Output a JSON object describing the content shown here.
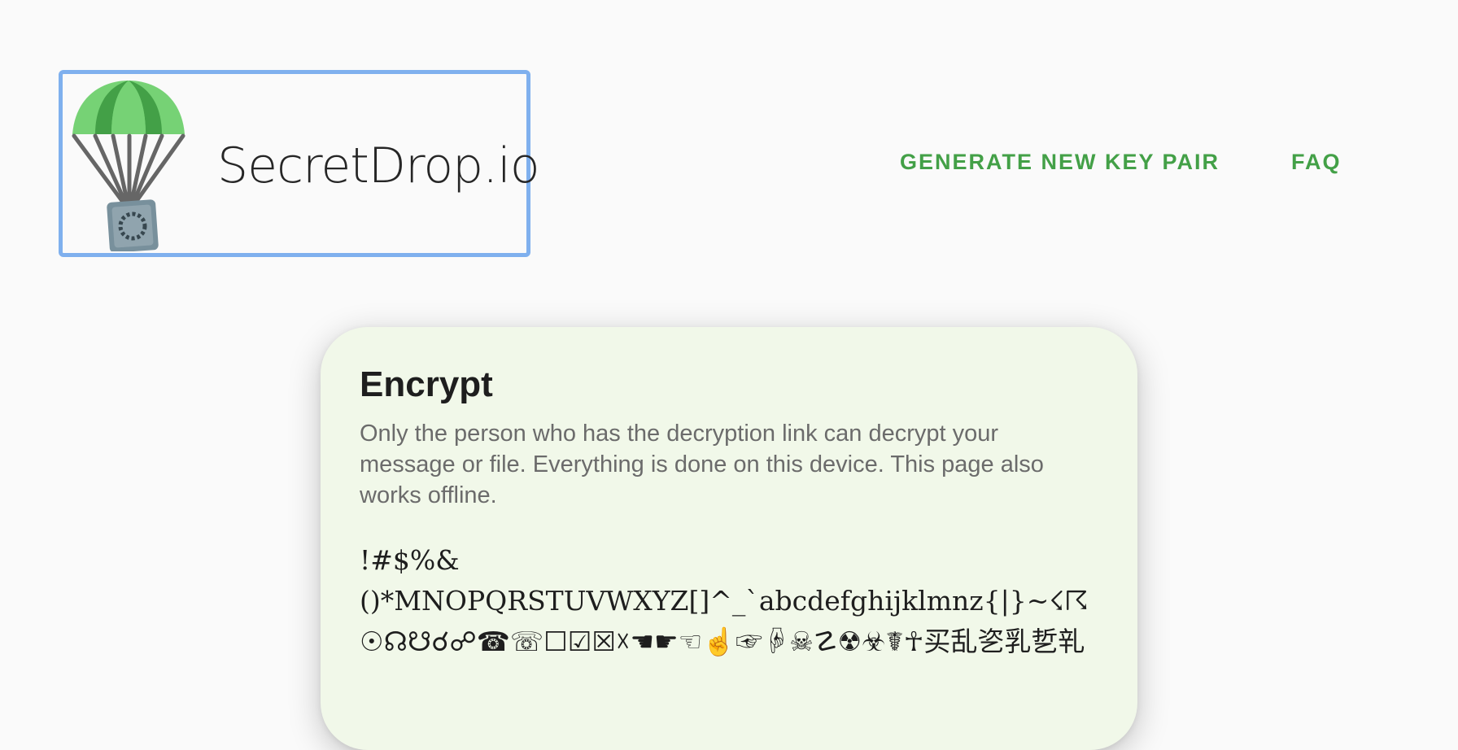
{
  "header": {
    "site_name": "SecretDrop.io",
    "nav": {
      "generate_label": "GENERATE NEW KEY PAIR",
      "faq_label": "FAQ"
    }
  },
  "colors": {
    "accent_green": "#43a047",
    "card_background": "#f1f8e9",
    "focus_outline": "#7fb0ee"
  },
  "encrypt_card": {
    "title": "Encrypt",
    "description": "Only the person who has the decryption link can decrypt your message or file. Everything is done on this device. This page also works offline.",
    "glyph_lines": [
      "!#$%&",
      "()*MNOPQRSTUVWXYZ[]^_`abcdefghijklmnz{|}~☇☈",
      "☉☊☋☌☍☎☏☐☑☒☓☚☛☜☝☞☟☠☡☢☣☤☥买乱乲乳乴乵"
    ]
  }
}
